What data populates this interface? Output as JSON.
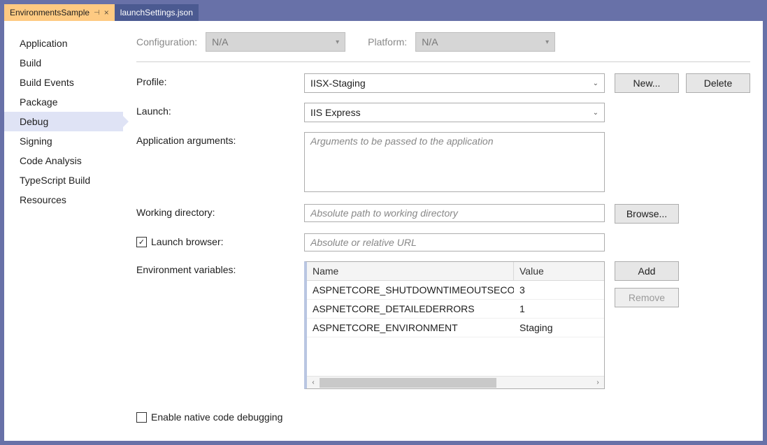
{
  "tabs": [
    {
      "label": "EnvironmentsSample",
      "active": true,
      "pinned": true,
      "closable": true
    },
    {
      "label": "launchSettings.json",
      "active": false
    }
  ],
  "sidebar": {
    "items": [
      {
        "label": "Application"
      },
      {
        "label": "Build"
      },
      {
        "label": "Build Events"
      },
      {
        "label": "Package"
      },
      {
        "label": "Debug"
      },
      {
        "label": "Signing"
      },
      {
        "label": "Code Analysis"
      },
      {
        "label": "TypeScript Build"
      },
      {
        "label": "Resources"
      }
    ],
    "selected_index": 4
  },
  "top": {
    "configuration_label": "Configuration:",
    "configuration_value": "N/A",
    "platform_label": "Platform:",
    "platform_value": "N/A"
  },
  "form": {
    "profile_label": "Profile:",
    "profile_value": "IISX-Staging",
    "new_button": "New...",
    "delete_button": "Delete",
    "launch_label": "Launch:",
    "launch_value": "IIS Express",
    "args_label": "Application arguments:",
    "args_placeholder": "Arguments to be passed to the application",
    "workdir_label": "Working directory:",
    "workdir_placeholder": "Absolute path to working directory",
    "browse_button": "Browse...",
    "launch_browser_label": "Launch browser:",
    "launch_browser_checked": true,
    "launch_browser_placeholder": "Absolute or relative URL",
    "env_label": "Environment variables:",
    "env_headers": {
      "name": "Name",
      "value": "Value"
    },
    "env_rows": [
      {
        "name": "ASPNETCORE_SHUTDOWNTIMEOUTSECONDS",
        "value": "3"
      },
      {
        "name": "ASPNETCORE_DETAILEDERRORS",
        "value": "1"
      },
      {
        "name": "ASPNETCORE_ENVIRONMENT",
        "value": "Staging"
      }
    ],
    "add_button": "Add",
    "remove_button": "Remove",
    "native_debug_label": "Enable native code debugging",
    "native_debug_checked": false
  }
}
